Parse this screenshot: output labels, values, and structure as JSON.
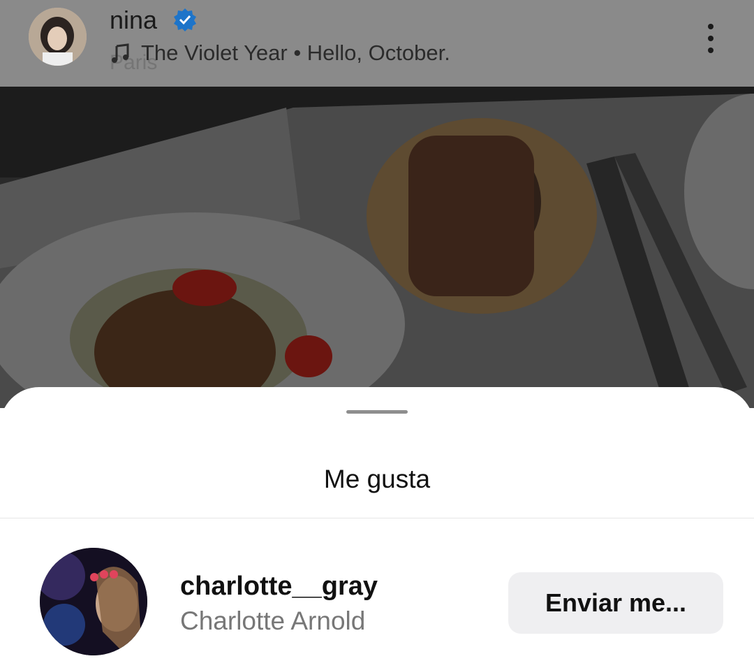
{
  "header": {
    "username": "nina",
    "verified_icon": "verified-badge-icon",
    "music_icon": "music-note-icon",
    "song": "The Violet Year • Hello, October.",
    "location": "Paris",
    "more_icon": "more-vertical-icon"
  },
  "post": {
    "image_description_icon": "post-photo"
  },
  "sheet": {
    "title": "Me gusta"
  },
  "likes": [
    {
      "username": "charlotte__gray",
      "full_name": "Charlotte Arnold",
      "button_label": "Enviar me..."
    }
  ],
  "colors": {
    "verified": "#1d74c9",
    "overlay": "#8a8a8a",
    "button_bg": "#efeff1",
    "secondary_text": "#777777"
  }
}
